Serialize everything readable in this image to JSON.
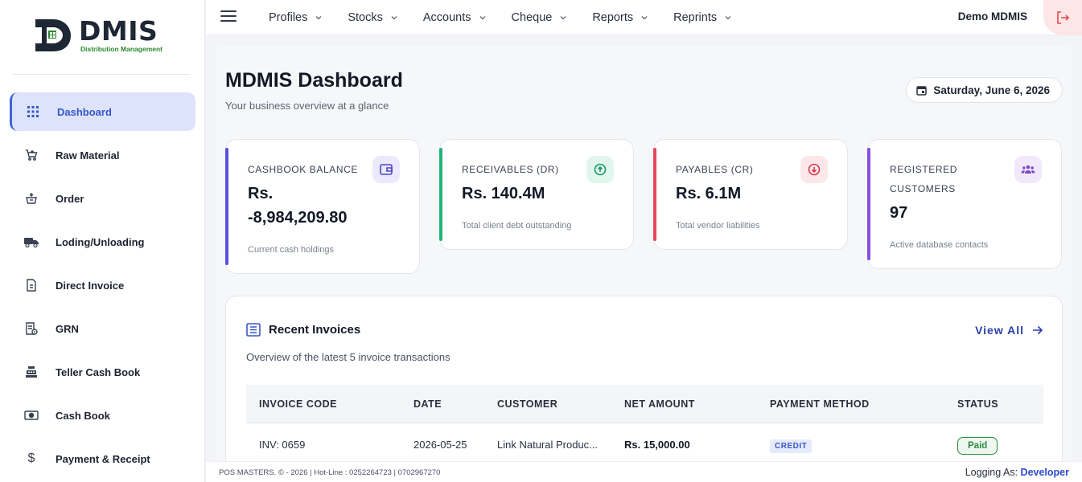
{
  "brand": {
    "name": "DMIS",
    "subtitle": "Distribution Management"
  },
  "sidebar": {
    "items": [
      {
        "label": "Dashboard",
        "icon": "grid-icon",
        "active": true
      },
      {
        "label": "Raw Material",
        "icon": "cart-icon"
      },
      {
        "label": "Order",
        "icon": "basket-icon"
      },
      {
        "label": "Loding/Unloading",
        "icon": "truck-icon"
      },
      {
        "label": "Direct Invoice",
        "icon": "document-icon"
      },
      {
        "label": "GRN",
        "icon": "receipt-icon"
      },
      {
        "label": "Teller Cash Book",
        "icon": "cash-register-icon"
      },
      {
        "label": "Cash Book",
        "icon": "money-icon"
      },
      {
        "label": "Payment & Receipt",
        "icon": "dollar-icon"
      }
    ]
  },
  "topbar": {
    "menu": [
      "Profiles",
      "Stocks",
      "Accounts",
      "Cheque",
      "Reports",
      "Reprints"
    ],
    "user": "Demo MDMIS"
  },
  "page": {
    "title": "MDMIS Dashboard",
    "subtitle": "Your business overview at a glance",
    "date": "Saturday, June 6, 2026"
  },
  "cards": [
    {
      "label": "CASHBOOK BALANCE",
      "value": "Rs. -8,984,209.80",
      "desc": "Current cash holdings",
      "accent": "#5b4fe0",
      "icon": "wallet-icon"
    },
    {
      "label": "RECEIVABLES (DR)",
      "value": "Rs. 140.4M",
      "desc": "Total client debt outstanding",
      "accent": "#1fb57a",
      "icon": "arrow-up-circle-icon"
    },
    {
      "label": "PAYABLES (CR)",
      "value": "Rs. 6.1M",
      "desc": "Total vendor liabilities",
      "accent": "#e8455a",
      "icon": "arrow-down-circle-icon"
    },
    {
      "label": "REGISTERED CUSTOMERS",
      "value": "97",
      "desc": "Active database contacts",
      "accent": "#8b4fe0",
      "icon": "users-icon"
    }
  ],
  "invoices": {
    "title": "Recent Invoices",
    "subtitle": "Overview of the latest 5 invoice transactions",
    "view_all": "View All",
    "columns": [
      "INVOICE CODE",
      "DATE",
      "CUSTOMER",
      "NET AMOUNT",
      "PAYMENT METHOD",
      "STATUS"
    ],
    "rows": [
      {
        "code": "INV: 0659",
        "date": "2026-05-25",
        "customer": "Link Natural Produc...",
        "amount": "Rs. 15,000.00",
        "method": "CREDIT",
        "status": "Paid"
      }
    ]
  },
  "footer": {
    "left": "POS MASTERS. © - 2026 | Hot-Line : 0252264723 | 0702967270",
    "right_prefix": "Logging As:",
    "right_user": "Developer"
  }
}
